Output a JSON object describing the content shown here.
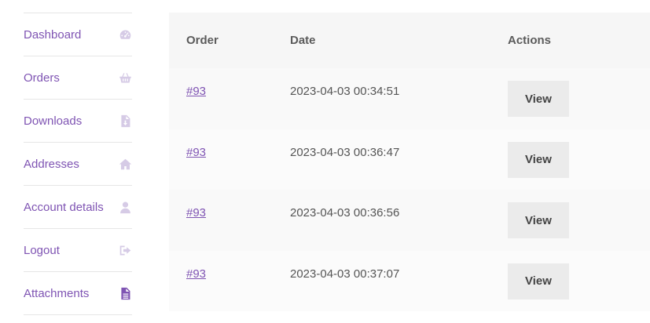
{
  "sidebar": {
    "items": [
      {
        "label": "Dashboard",
        "icon": "dashboard-icon"
      },
      {
        "label": "Orders",
        "icon": "basket-icon"
      },
      {
        "label": "Downloads",
        "icon": "file-download-icon"
      },
      {
        "label": "Addresses",
        "icon": "home-icon"
      },
      {
        "label": "Account details",
        "icon": "user-icon"
      },
      {
        "label": "Logout",
        "icon": "sign-out-icon"
      },
      {
        "label": "Attachments",
        "icon": "document-icon"
      }
    ],
    "active_item": "Attachments"
  },
  "orders_table": {
    "headers": {
      "order": "Order",
      "date": "Date",
      "actions": "Actions"
    },
    "rows": [
      {
        "order": "#93",
        "date": "2023-04-03 00:34:51",
        "action": "View"
      },
      {
        "order": "#93",
        "date": "2023-04-03 00:36:47",
        "action": "View"
      },
      {
        "order": "#93",
        "date": "2023-04-03 00:36:56",
        "action": "View"
      },
      {
        "order": "#93",
        "date": "2023-04-03 00:37:07",
        "action": "View"
      }
    ]
  },
  "colors": {
    "accent": "#7f54b3",
    "icon_inactive": "#d6cbe6",
    "header_bg": "#f6f6f6",
    "button_bg": "#ebebeb"
  }
}
